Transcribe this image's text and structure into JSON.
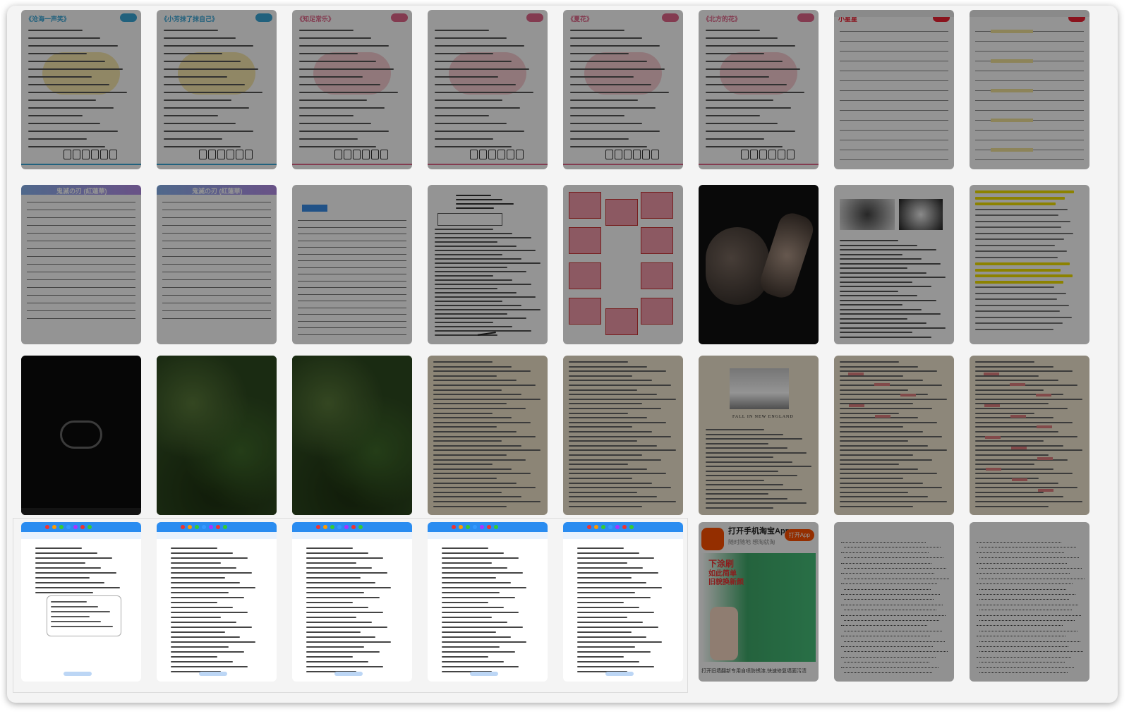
{
  "window": {
    "title": "page-overview"
  },
  "row1": {
    "pages": [
      {
        "title": "《沧海一声笑》",
        "theme": "#3aa7d8"
      },
      {
        "title": "《小芳抹了抹自己》",
        "theme": "#3aa7d8"
      },
      {
        "title": "《知足常乐》",
        "theme": "#e2668a"
      },
      {
        "title": "",
        "theme": "#e2668a"
      },
      {
        "title": "《夏花》",
        "theme": "#e2668a"
      },
      {
        "title": "《北方的花》",
        "theme": "#e2668a"
      },
      {
        "title": "小星星",
        "theme": "#e23"
      },
      {
        "title": "",
        "theme": "#e23"
      }
    ]
  },
  "row2": {
    "pages": [
      {
        "title": "鬼滅の刃 (紅蓮華)",
        "theme": "#8a6ad8"
      },
      {
        "title": "鬼滅の刃 (紅蓮華)",
        "theme": "#8a6ad8"
      },
      {
        "title": "",
        "theme": "#3aa7d8"
      },
      {
        "title": "",
        "theme": "#333"
      },
      {
        "title": "",
        "theme": "#c33"
      },
      {
        "title": "",
        "theme": "#111"
      },
      {
        "title": "",
        "theme": "#333"
      },
      {
        "title": "",
        "theme": "#e8d400"
      }
    ]
  },
  "row3": {
    "news_caption": "FALL IN NEW ENGLAND"
  },
  "row4": {
    "ad": {
      "title": "打开手机淘宝App",
      "subtitle": "随时随地  想淘就淘",
      "button": "打开App",
      "slogan1": "下涂刷",
      "slogan2": "如此简单",
      "slogan3": "旧貌换新颜",
      "footer": "打开旧墙翻新专用自喷防锈漆,快速修复墙面污渍"
    }
  },
  "colors": {
    "overlay": "rgba(0,0,0,0.42)",
    "accent": "#2a8cf0"
  }
}
